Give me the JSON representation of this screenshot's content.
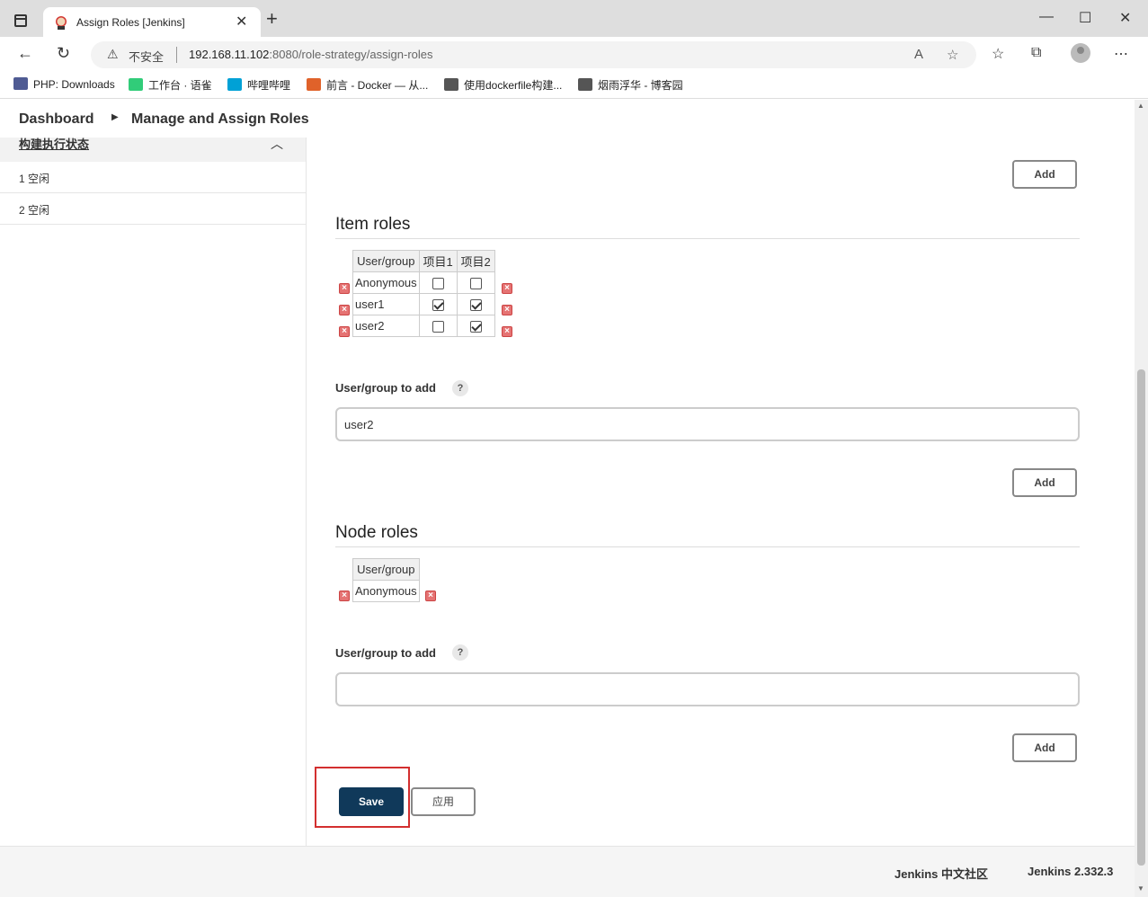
{
  "browser": {
    "tab_title": "Assign Roles [Jenkins]",
    "address_insecure": "不安全",
    "address_host": "192.168.11.102",
    "address_rest": ":8080/role-strategy/assign-roles",
    "bookmarks": [
      {
        "label": "PHP: Downloads",
        "icon": "php-icon",
        "color": "#4f5b93"
      },
      {
        "label": "工作台 · 语雀",
        "icon": "yuque-icon",
        "color": "#31cc79"
      },
      {
        "label": "哔哩哔哩",
        "icon": "bilibili-icon",
        "color": "#00a1d6"
      },
      {
        "label": "前言 - Docker — 从...",
        "icon": "rocket-icon",
        "color": "#e0622a"
      },
      {
        "label": "使用dockerfile构建...",
        "icon": "cnblogs-icon",
        "color": "#555555"
      },
      {
        "label": "烟雨浮华 - 博客园",
        "icon": "cnblogs-icon",
        "color": "#555555"
      }
    ]
  },
  "breadcrumb": {
    "dashboard": "Dashboard",
    "current": "Manage and Assign Roles"
  },
  "sidebar": {
    "executor_title": "构建执行状态",
    "executors": [
      "1  空闲",
      "2  空闲"
    ]
  },
  "main": {
    "add_label": "Add",
    "item_roles": {
      "title": "Item roles",
      "columns": [
        "User/group",
        "项目1",
        "项目2"
      ],
      "rows": [
        {
          "user": "Anonymous",
          "checks": [
            false,
            false
          ]
        },
        {
          "user": "user1",
          "checks": [
            true,
            true
          ]
        },
        {
          "user": "user2",
          "checks": [
            false,
            true
          ]
        }
      ],
      "field_label": "User/group to add",
      "field_value": "user2"
    },
    "node_roles": {
      "title": "Node roles",
      "columns": [
        "User/group"
      ],
      "rows": [
        {
          "user": "Anonymous"
        }
      ],
      "field_label": "User/group to add",
      "field_value": ""
    },
    "save_label": "Save",
    "apply_label": "应用",
    "help_glyph": "?"
  },
  "footer": {
    "community": "Jenkins 中文社区",
    "version": "Jenkins 2.332.3"
  },
  "colors": {
    "save_button": "#10395a",
    "highlight_frame": "#d32f2f",
    "delete_icon": "#e57373"
  }
}
